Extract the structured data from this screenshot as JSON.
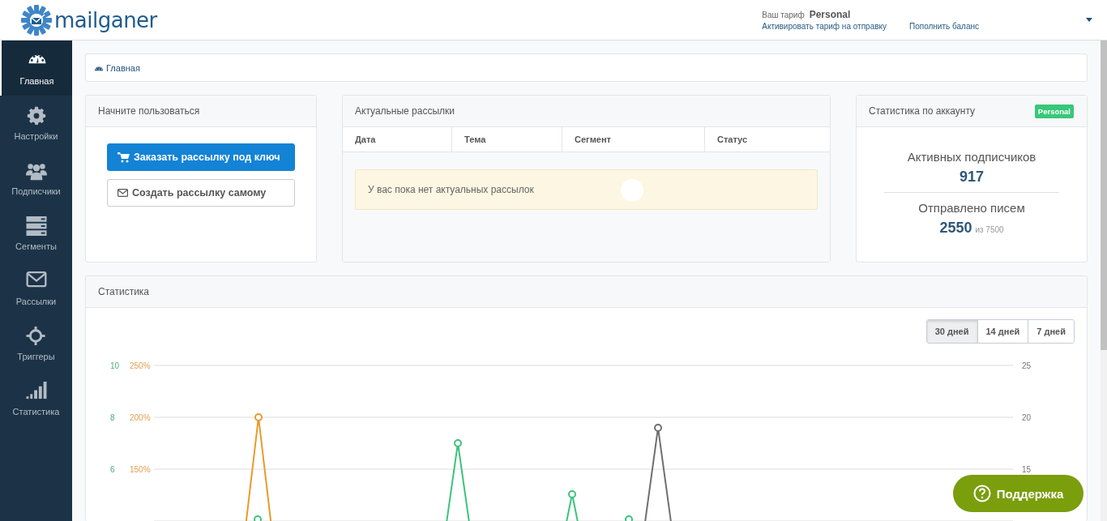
{
  "header": {
    "logo_text": "mailganer",
    "plan_label": "Ваш тариф",
    "plan_name": "Personal",
    "links": [
      "Активировать тариф на отправку",
      "Пополнить баланс"
    ]
  },
  "sidebar": {
    "items": [
      {
        "label": "Главная",
        "selected": true
      },
      {
        "label": "Настройки",
        "selected": false
      },
      {
        "label": "Подписчики",
        "selected": false
      },
      {
        "label": "Сегменты",
        "selected": false
      },
      {
        "label": "Рассылки",
        "selected": false
      },
      {
        "label": "Триггеры",
        "selected": false
      },
      {
        "label": "Статистика",
        "selected": false
      }
    ]
  },
  "breadcrumb": "Главная",
  "start_card": {
    "title": "Начните пользоваться",
    "buttons": [
      {
        "label": "Заказать рассылку под ключ",
        "kind": "primary"
      },
      {
        "label": "Создать рассылку самому",
        "kind": "outline"
      }
    ]
  },
  "mailings_card": {
    "title": "Актуальные рассылки",
    "columns": [
      "Дата",
      "Тема",
      "Сегмент",
      "Статус"
    ],
    "empty_message": "У вас пока нет актуальных рассылок"
  },
  "account_card": {
    "title": "Статистика по аккаунту",
    "badge": "Personal",
    "subscribers_label": "Активных подписчиков",
    "subscribers_value": "917",
    "sent_label": "Отправлено писем",
    "sent_value": "2550",
    "sent_limit": "из 7500"
  },
  "stats_panel": {
    "title": "Статистика",
    "ranges": [
      {
        "label": "30 дней",
        "selected": true
      },
      {
        "label": "14 дней",
        "selected": false
      },
      {
        "label": "7 дней",
        "selected": false
      }
    ],
    "left_ticks": [
      "10",
      "8",
      "6"
    ],
    "percent_ticks": [
      "250%",
      "200%",
      "150%"
    ],
    "right_ticks": [
      "25",
      "20",
      "15"
    ]
  },
  "support_button": "Поддержка"
}
